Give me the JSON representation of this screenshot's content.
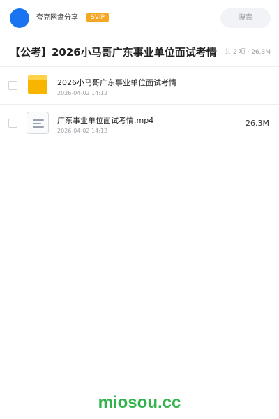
{
  "header": {
    "user_name": "夸克网盘分享",
    "badge": "SVIP",
    "search_placeholder": "搜索"
  },
  "title_bar": {
    "title": "【公考】2026小马哥广东事业单位面试考情",
    "meta": "共 2 项 · 26.3M"
  },
  "files": [
    {
      "type": "folder",
      "icon": "folder-icon",
      "name": "2026小马哥广东事业单位面试考情",
      "date": "2026-04-02 14:12",
      "size": ""
    },
    {
      "type": "video",
      "icon": "video-file-icon",
      "name": "广东事业单位面试考情.mp4",
      "date": "2026-04-02 14:12",
      "size": "26.3M"
    }
  ],
  "footer": {
    "watermark": "miosou.cc"
  },
  "colors": {
    "avatar": "#1a73f0",
    "svip_badge": "#f5a623",
    "folder": "#f7b500",
    "watermark": "#2fb34a"
  }
}
